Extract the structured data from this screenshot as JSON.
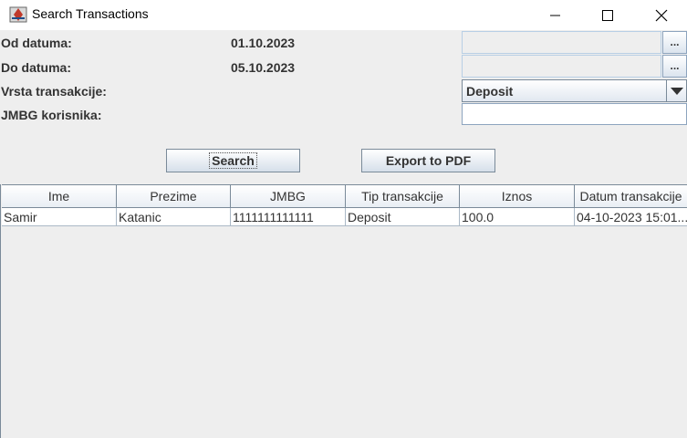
{
  "window": {
    "title": "Search Transactions"
  },
  "form": {
    "from_label": "Od datuma:",
    "from_value": "01.10.2023",
    "to_label": "Do datuma:",
    "to_value": "05.10.2023",
    "type_label": "Vrsta transakcije:",
    "type_selected": "Deposit",
    "jmbg_label": "JMBG korisnika:",
    "jmbg_value": "",
    "picker_label": "..."
  },
  "buttons": {
    "search": "Search",
    "export": "Export to PDF"
  },
  "table": {
    "columns": [
      "Ime",
      "Prezime",
      "JMBG",
      "Tip transakcije",
      "Iznos",
      "Datum transakcije"
    ],
    "rows": [
      [
        "Samir",
        "Katanic",
        "1111111111111",
        "Deposit",
        "100.0",
        "04-10-2023 15:01..."
      ]
    ]
  }
}
